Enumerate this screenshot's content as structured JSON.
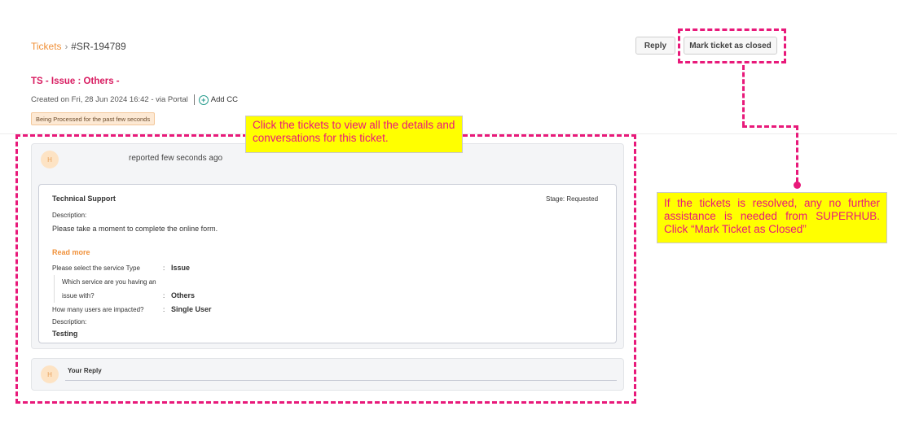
{
  "breadcrumb": {
    "root": "Tickets",
    "separator": "›",
    "ticket_id": "#SR-194789"
  },
  "actions": {
    "reply_label": "Reply",
    "close_label": "Mark ticket as closed"
  },
  "ticket": {
    "title": "TS - Issue : Others -",
    "created": "Created on Fri, 28 Jun 2024 16:42 - via Portal",
    "add_cc": "Add CC",
    "status": "Being Processed for the past few seconds"
  },
  "conversation": {
    "avatar_initial": "H",
    "reported": "reported few seconds ago",
    "form": {
      "category": "Technical Support",
      "stage": "Stage: Requested",
      "description_label": "Description:",
      "description_text": "Please take a moment to complete the online form.",
      "read_more": "Read more",
      "fields": [
        {
          "label": "Please select the service Type",
          "colon": ":",
          "value": "Issue"
        },
        {
          "label_line1": "Which service are you having an",
          "label_line2": "issue with?",
          "colon": ":",
          "value": "Others"
        },
        {
          "label": "How many users are impacted?",
          "colon": ":",
          "value": "Single User"
        }
      ],
      "description2_label": "Description:",
      "description2_value": "Testing"
    },
    "reply": {
      "avatar_initial": "H",
      "label": "Your Reply"
    }
  },
  "annotations": {
    "callout_left": "Click the tickets to view all the details and conversations for this ticket.",
    "callout_right": "If the tickets is resolved, any no further assistance is needed from SUPERHUB. Click “Mark Ticket as Closed”"
  },
  "colors": {
    "accent": "#f0913a",
    "title": "#d81b60",
    "annotation": "#e8197a",
    "callout_bg": "#ffff00"
  }
}
